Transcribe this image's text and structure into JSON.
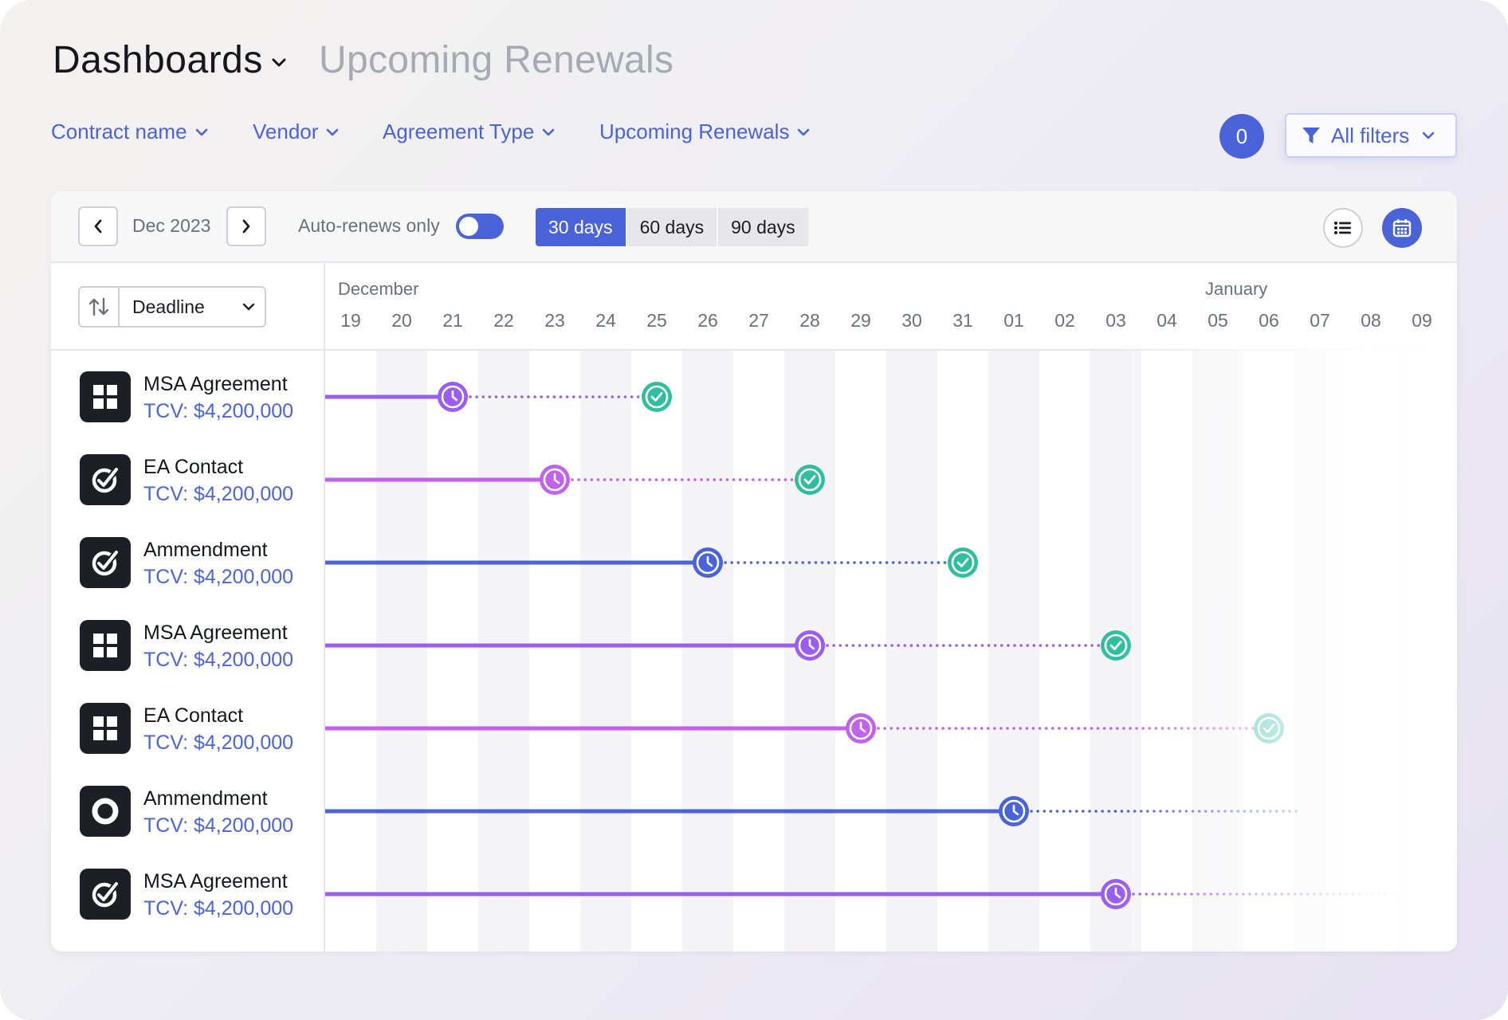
{
  "header": {
    "title": "Dashboards",
    "subtitle": "Upcoming Renewals"
  },
  "filters": [
    {
      "label": "Contract name"
    },
    {
      "label": "Vendor"
    },
    {
      "label": "Agreement Type"
    },
    {
      "label": "Upcoming Renewals"
    }
  ],
  "filter_count": "0",
  "all_filters_label": "All filters",
  "toolbar": {
    "month": "Dec 2023",
    "auto_renews_label": "Auto-renews only",
    "auto_renews_on": true,
    "ranges": [
      "30 days",
      "60 days",
      "90 days"
    ],
    "active_range": "30 days"
  },
  "sort": {
    "label": "Deadline"
  },
  "timeline": {
    "months": [
      {
        "label": "December",
        "start_index": 0
      },
      {
        "label": "January",
        "start_index": 17
      }
    ],
    "days": [
      "19",
      "20",
      "21",
      "22",
      "23",
      "24",
      "25",
      "26",
      "27",
      "28",
      "29",
      "30",
      "31",
      "01",
      "02",
      "03",
      "04",
      "05",
      "06",
      "07",
      "08",
      "09"
    ]
  },
  "colors": {
    "accent": "#4b63d8",
    "blue": "#4b63d8",
    "violet": "#9b5cf0",
    "purple": "#c262ec",
    "green": "#2fbf9f"
  },
  "rows": [
    {
      "name": "MSA Agreement",
      "tcv": "TCV: $4,200,000",
      "icon": "grid-icon",
      "color": "violet",
      "deadline_index": 2,
      "renewal_index": 6
    },
    {
      "name": "EA Contact",
      "tcv": "TCV: $4,200,000",
      "icon": "checkmark-icon",
      "color": "purple",
      "deadline_index": 4,
      "renewal_index": 9
    },
    {
      "name": "Ammendment",
      "tcv": "TCV: $4,200,000",
      "icon": "checkmark-icon",
      "color": "blue",
      "deadline_index": 7,
      "renewal_index": 12
    },
    {
      "name": "MSA Agreement",
      "tcv": "TCV: $4,200,000",
      "icon": "grid-icon",
      "color": "violet",
      "deadline_index": 9,
      "renewal_index": 15
    },
    {
      "name": "EA Contact",
      "tcv": "TCV: $4,200,000",
      "icon": "grid-icon",
      "color": "purple",
      "deadline_index": 10,
      "renewal_index": 18
    },
    {
      "name": "Ammendment",
      "tcv": "TCV: $4,200,000",
      "icon": "circle-icon",
      "color": "blue",
      "deadline_index": 13,
      "renewal_index": null
    },
    {
      "name": "MSA Agreement",
      "tcv": "TCV: $4,200,000",
      "icon": "checkmark-icon",
      "color": "violet",
      "deadline_index": 15,
      "renewal_index": null
    }
  ]
}
